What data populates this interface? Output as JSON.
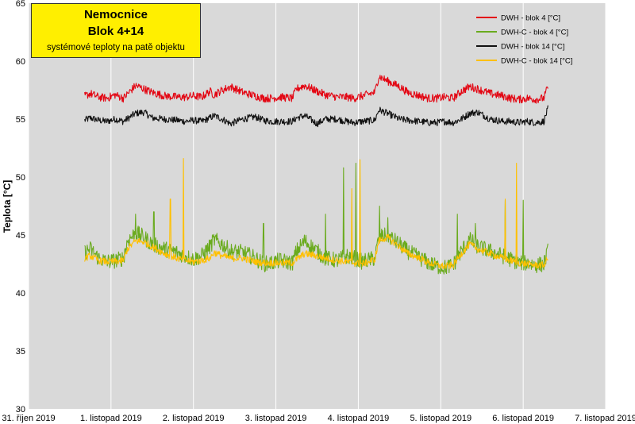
{
  "title": {
    "line1": "Nemocnice",
    "line2": "Blok 4+14",
    "line3": "systémové teploty na patě objektu"
  },
  "chart_data": {
    "type": "line",
    "ylabel": "Teplota [°C]",
    "ylim": [
      30,
      65
    ],
    "yticks": [
      "30",
      "35",
      "40",
      "45",
      "50",
      "55",
      "60",
      "65"
    ],
    "xlim": [
      "2019-10-31",
      "2019-11-07"
    ],
    "xticks": [
      "31. říjen 2019",
      "1. listopad 2019",
      "2. listopad 2019",
      "3. listopad 2019",
      "4. listopad 2019",
      "5. listopad 2019",
      "6. listopad 2019",
      "7. listopad 2019"
    ],
    "grid": "vertical",
    "legend_position": "top-right",
    "series": [
      {
        "name": "DWH - blok 4 [°C]",
        "color": "#e30613",
        "x": [
          0.68,
          0.75,
          0.85,
          0.95,
          1.05,
          1.15,
          1.3,
          1.4,
          1.5,
          1.65,
          1.8,
          1.9,
          2.0,
          2.1,
          2.2,
          2.25,
          2.35,
          2.45,
          2.6,
          2.75,
          2.85,
          2.95,
          3.05,
          3.2,
          3.25,
          3.35,
          3.5,
          3.6,
          3.75,
          3.85,
          3.95,
          4.05,
          4.2,
          4.25,
          4.35,
          4.5,
          4.6,
          4.75,
          4.85,
          4.95,
          5.05,
          5.15,
          5.25,
          5.35,
          5.45,
          5.6,
          5.75,
          5.85,
          5.95,
          6.05,
          6.15,
          6.25,
          6.3
        ],
        "y": [
          57.0,
          57.2,
          56.9,
          56.8,
          57.1,
          56.8,
          57.9,
          57.6,
          57.3,
          57.0,
          56.9,
          56.9,
          57.0,
          56.9,
          57.4,
          57.1,
          57.5,
          57.8,
          57.3,
          57.0,
          56.8,
          56.8,
          56.9,
          56.8,
          57.6,
          57.9,
          57.4,
          57.1,
          56.9,
          56.9,
          56.8,
          57.0,
          57.3,
          58.7,
          58.3,
          57.8,
          57.3,
          57.0,
          56.8,
          56.8,
          56.9,
          56.8,
          57.4,
          57.8,
          57.6,
          57.2,
          57.0,
          56.8,
          56.7,
          56.8,
          56.7,
          56.8,
          57.8
        ]
      },
      {
        "name": "DWH-C - blok 4 [°C]",
        "color": "#6aab1e",
        "x": [
          0.68,
          0.75,
          0.85,
          0.95,
          1.05,
          1.15,
          1.2,
          1.3,
          1.4,
          1.5,
          1.65,
          1.8,
          1.9,
          2.0,
          2.1,
          2.2,
          2.25,
          2.35,
          2.45,
          2.6,
          2.75,
          2.85,
          2.95,
          3.05,
          3.2,
          3.25,
          3.35,
          3.5,
          3.6,
          3.75,
          3.85,
          3.95,
          4.05,
          4.2,
          4.25,
          4.35,
          4.5,
          4.6,
          4.75,
          4.85,
          4.95,
          5.05,
          5.15,
          5.25,
          5.35,
          5.45,
          5.6,
          5.75,
          5.85,
          5.95,
          6.05,
          6.15,
          6.25,
          6.3
        ],
        "y": [
          43.5,
          43.8,
          43.0,
          42.7,
          42.8,
          43.0,
          44.5,
          45.2,
          44.8,
          44.2,
          43.8,
          43.5,
          43.2,
          42.9,
          43.2,
          44.0,
          44.6,
          44.2,
          43.6,
          43.5,
          43.0,
          42.5,
          42.6,
          42.8,
          42.6,
          43.6,
          44.5,
          43.6,
          43.0,
          42.8,
          43.2,
          43.0,
          42.7,
          43.0,
          44.8,
          45.0,
          44.2,
          43.6,
          43.0,
          42.6,
          42.3,
          42.2,
          42.4,
          43.6,
          44.6,
          44.0,
          43.6,
          43.2,
          42.9,
          42.6,
          42.6,
          42.4,
          42.5,
          43.6
        ]
      },
      {
        "name": "DWH - blok 14 [°C]",
        "color": "#111111",
        "x": [
          0.68,
          0.75,
          0.85,
          0.95,
          1.05,
          1.15,
          1.3,
          1.4,
          1.5,
          1.65,
          1.8,
          1.9,
          2.0,
          2.1,
          2.2,
          2.25,
          2.35,
          2.45,
          2.6,
          2.75,
          2.85,
          2.95,
          3.05,
          3.2,
          3.25,
          3.35,
          3.5,
          3.6,
          3.75,
          3.85,
          3.95,
          4.05,
          4.2,
          4.25,
          4.35,
          4.5,
          4.6,
          4.75,
          4.85,
          4.95,
          5.05,
          5.15,
          5.25,
          5.35,
          5.45,
          5.6,
          5.75,
          5.85,
          5.95,
          6.05,
          6.15,
          6.25,
          6.3
        ],
        "y": [
          54.9,
          55.1,
          54.9,
          54.8,
          55.0,
          54.8,
          55.5,
          55.6,
          55.1,
          55.0,
          54.9,
          54.8,
          54.9,
          54.8,
          55.1,
          55.3,
          55.0,
          54.6,
          55.0,
          55.2,
          54.9,
          54.8,
          54.8,
          54.8,
          55.1,
          55.3,
          54.6,
          55.0,
          55.0,
          54.8,
          54.7,
          54.8,
          54.9,
          55.8,
          55.5,
          55.0,
          54.9,
          54.8,
          54.7,
          54.7,
          54.8,
          54.7,
          55.0,
          55.5,
          55.6,
          55.0,
          54.8,
          54.8,
          54.7,
          54.8,
          54.7,
          54.8,
          55.9
        ]
      },
      {
        "name": "DWH-C - blok 14 [°C]",
        "color": "#ffc000",
        "x": [
          0.68,
          0.75,
          0.85,
          0.95,
          1.05,
          1.15,
          1.2,
          1.3,
          1.4,
          1.5,
          1.65,
          1.8,
          1.9,
          2.0,
          2.1,
          2.2,
          2.25,
          2.35,
          2.45,
          2.6,
          2.75,
          2.85,
          2.95,
          3.05,
          3.2,
          3.25,
          3.35,
          3.5,
          3.6,
          3.75,
          3.85,
          3.95,
          4.05,
          4.2,
          4.25,
          4.35,
          4.5,
          4.6,
          4.75,
          4.85,
          4.95,
          5.05,
          5.15,
          5.25,
          5.35,
          5.45,
          5.6,
          5.75,
          5.85,
          5.95,
          6.05,
          6.15,
          6.25,
          6.3
        ],
        "y": [
          43.0,
          43.2,
          42.8,
          42.7,
          42.7,
          42.8,
          43.8,
          44.5,
          44.4,
          44.0,
          43.4,
          43.0,
          42.8,
          42.7,
          42.8,
          43.0,
          43.5,
          43.2,
          43.0,
          43.0,
          42.7,
          42.6,
          42.6,
          42.6,
          42.6,
          42.9,
          43.4,
          43.2,
          43.0,
          42.8,
          42.7,
          42.6,
          42.5,
          42.9,
          44.5,
          44.8,
          44.0,
          43.4,
          43.0,
          42.6,
          42.4,
          42.3,
          42.4,
          43.4,
          44.2,
          43.8,
          43.4,
          43.0,
          42.8,
          42.6,
          42.5,
          42.4,
          42.4,
          43.0
        ]
      }
    ],
    "spikes": [
      {
        "series": 1,
        "x": [
          1.3,
          1.52,
          2.85,
          3.6,
          3.82,
          3.97,
          4.26,
          4.36,
          5.2,
          5.42,
          5.78,
          6.0
        ],
        "y": [
          46.8,
          47.0,
          46.0,
          46.8,
          50.8,
          51.2,
          47.5,
          46.5,
          46.8,
          46.0,
          48.0,
          48.0
        ]
      },
      {
        "series": 3,
        "x": [
          1.72,
          1.88,
          3.92,
          4.02,
          5.78,
          5.92
        ],
        "y": [
          48.1,
          51.6,
          49.0,
          51.5,
          48.1,
          51.2
        ]
      }
    ]
  }
}
